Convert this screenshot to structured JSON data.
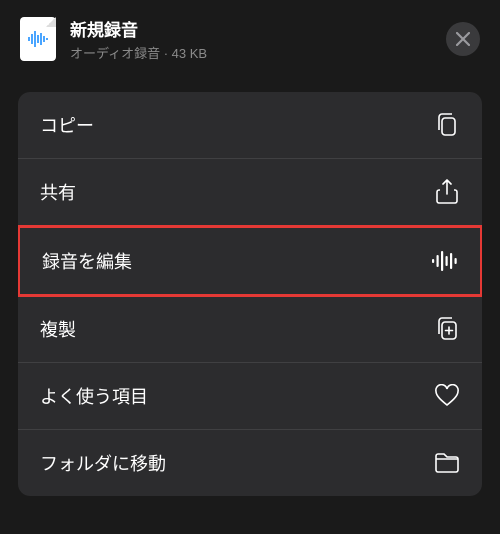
{
  "header": {
    "title": "新規録音",
    "subtitle": "オーディオ録音 · 43 KB"
  },
  "menu": {
    "items": [
      {
        "label": "コピー",
        "icon": "copy-icon"
      },
      {
        "label": "共有",
        "icon": "share-icon"
      },
      {
        "label": "録音を編集",
        "icon": "waveform-icon",
        "highlighted": true
      },
      {
        "label": "複製",
        "icon": "duplicate-icon"
      },
      {
        "label": "よく使う項目",
        "icon": "heart-icon"
      },
      {
        "label": "フォルダに移動",
        "icon": "folder-icon"
      }
    ]
  }
}
